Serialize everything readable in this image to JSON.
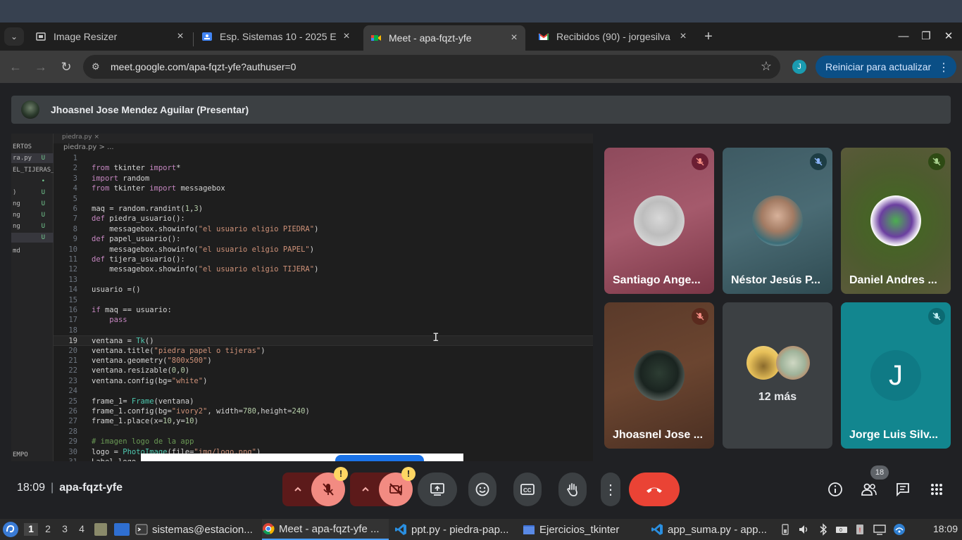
{
  "browser": {
    "tabs": [
      {
        "label": "Image Resizer",
        "close": "×"
      },
      {
        "label": "Esp. Sistemas 10 - 2025 E",
        "close": "×"
      },
      {
        "label": "Meet - apa-fqzt-yfe",
        "close": "×"
      },
      {
        "label": "Recibidos (90) - jorgesilva",
        "close": "×"
      }
    ],
    "new_tab": "+",
    "url": "meet.google.com/apa-fqzt-yfe?authuser=0",
    "profile_initial": "J",
    "update_button": "Reiniciar para actualizar",
    "window_controls": {
      "minimize": "—",
      "maximize": "❐",
      "close": "✕"
    }
  },
  "meet": {
    "presenter": "Jhoasnel Jose Mendez Aguilar (Presentar)",
    "time": "18:09",
    "meeting_code": "apa-fqzt-yfe",
    "people_count": "18",
    "participants": [
      {
        "name": "Santiago Ange...",
        "muted": true
      },
      {
        "name": "Néstor Jesús P...",
        "muted": true
      },
      {
        "name": "Daniel Andres ...",
        "muted": true
      },
      {
        "name": "Jhoasnel Jose ...",
        "muted": true
      },
      {
        "name": "12 más",
        "muted": false
      },
      {
        "name": "Jorge Luis Silv...",
        "initial": "J",
        "muted": true
      }
    ],
    "colors": {
      "end_call": "#ea4335",
      "muted_red": "#f28b82",
      "warning": "#fdd663"
    }
  },
  "shared_screen": {
    "explorer_header": "ERTOS",
    "explorer_items": [
      {
        "label": "ra.py",
        "badge": "U"
      },
      {
        "label": "EL_TIJERAS_...",
        "badge": ""
      },
      {
        "label": "",
        "badge": "•"
      },
      {
        "label": ")",
        "badge": "U"
      },
      {
        "label": "ng",
        "badge": "U"
      },
      {
        "label": "ng",
        "badge": "U"
      },
      {
        "label": "ng",
        "badge": "U"
      },
      {
        "label": "",
        "badge": "U"
      },
      {
        "label": "md",
        "badge": ""
      }
    ],
    "explorer_footer": "EMPO",
    "editor_tab": "piedra.py ×",
    "breadcrumb": "piedra.py > ...",
    "code_lines": [
      {
        "n": "1",
        "t": ""
      },
      {
        "n": "2",
        "t": "from tkinter import*"
      },
      {
        "n": "3",
        "t": "import random"
      },
      {
        "n": "4",
        "t": "from tkinter import messagebox"
      },
      {
        "n": "5",
        "t": ""
      },
      {
        "n": "6",
        "t": "maq = random.randint(1,3)"
      },
      {
        "n": "7",
        "t": "def piedra_usuario():"
      },
      {
        "n": "8",
        "t": "    messagebox.showinfo(\"el usuario eligio PIEDRA\")"
      },
      {
        "n": "9",
        "t": "def papel_usuario():"
      },
      {
        "n": "10",
        "t": "    messagebox.showinfo(\"el usuario eligio PAPEL\")"
      },
      {
        "n": "11",
        "t": "def tijera_usuario():"
      },
      {
        "n": "12",
        "t": "    messagebox.showinfo(\"el usuario eligio TIJERA\")"
      },
      {
        "n": "13",
        "t": ""
      },
      {
        "n": "14",
        "t": "usuario =()"
      },
      {
        "n": "15",
        "t": ""
      },
      {
        "n": "16",
        "t": "if maq == usuario:"
      },
      {
        "n": "17",
        "t": "    pass"
      },
      {
        "n": "18",
        "t": ""
      },
      {
        "n": "19",
        "t": "ventana = Tk()"
      },
      {
        "n": "20",
        "t": "ventana.title(\"piedra papel o tijeras\")"
      },
      {
        "n": "21",
        "t": "ventana.geometry(\"800x500\")"
      },
      {
        "n": "22",
        "t": "ventana.resizable(0,0)"
      },
      {
        "n": "23",
        "t": "ventana.config(bg=\"white\")"
      },
      {
        "n": "24",
        "t": ""
      },
      {
        "n": "25",
        "t": "frame_1= Frame(ventana)"
      },
      {
        "n": "26",
        "t": "frame_1.config(bg=\"ivory2\", width=780,height=240)"
      },
      {
        "n": "27",
        "t": "frame_1.place(x=10,y=10)"
      },
      {
        "n": "28",
        "t": ""
      },
      {
        "n": "29",
        "t": "# imagen logo de la app"
      },
      {
        "n": "30",
        "t": "logo = PhotoImage(file=\"img/logo.png\")"
      },
      {
        "n": "31",
        "t": "Label_logo"
      }
    ],
    "current_line": "19"
  },
  "taskbar": {
    "workspaces": [
      "1",
      "2",
      "3",
      "4"
    ],
    "items": [
      "sistemas@estacion...",
      "Meet - apa-fqzt-yfe ...",
      "ppt.py - piedra-pap...",
      "Ejercicios_tkinter",
      "app_suma.py - app..."
    ],
    "clock": "18:09"
  }
}
